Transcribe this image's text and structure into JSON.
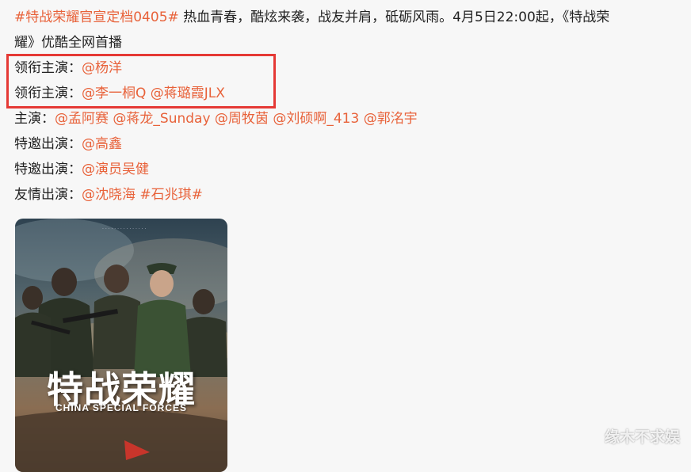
{
  "post": {
    "line1": {
      "tag": "#特战荣耀官宣定档0405#",
      "text": " 热血青春，酷炫来袭，战友并肩，砥砺风雨。4月5日22:00起，《特战荣"
    },
    "line2": {
      "text": "耀》优酷全网首播"
    },
    "lead1": {
      "label": "领衔主演：",
      "mention": "@杨洋"
    },
    "lead2": {
      "label": "领衔主演：",
      "mention1": "@李一桐Q",
      "mention2": "@蒋璐霞JLX"
    },
    "main_cast": {
      "label": "主演：",
      "mentions": [
        "@孟阿赛",
        "@蒋龙_Sunday",
        "@周牧茵",
        "@刘硕啊_413",
        "@郭洺宇"
      ]
    },
    "special1": {
      "label": "特邀出演：",
      "mention": "@高鑫"
    },
    "special2": {
      "label": "特邀出演：",
      "mention": "@演员吴健"
    },
    "friendship": {
      "label": "友情出演：",
      "mention": "@沈晓海",
      "tag": "#石兆琪#"
    }
  },
  "poster": {
    "title": "特战荣耀",
    "subtitle": "CHINA SPECIAL FORCES"
  },
  "watermark": "缘木不求娱",
  "colors": {
    "mention": "#e8623a",
    "highlight": "#e53935"
  }
}
